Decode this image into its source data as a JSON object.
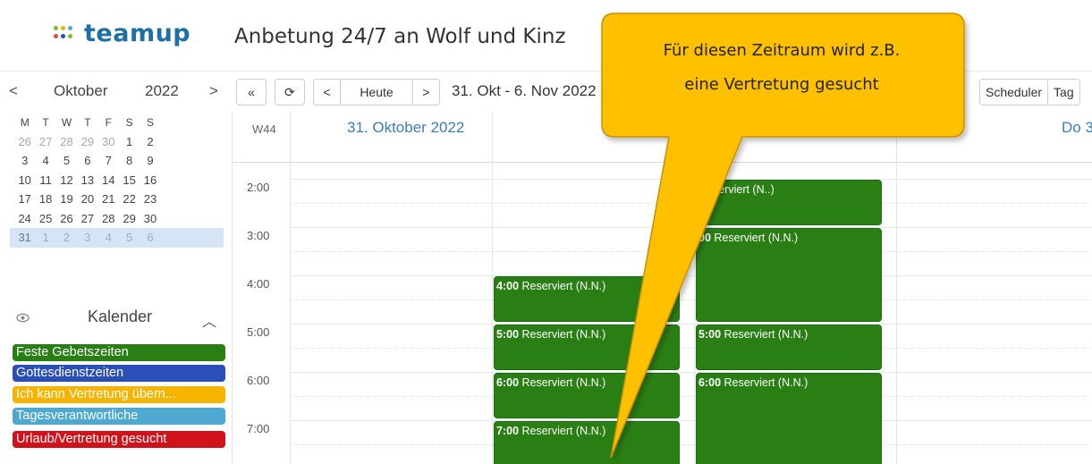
{
  "header": {
    "logo_text": "teamup",
    "title": "Anbetung 24/7 an Wolf und Kinz"
  },
  "mini_calendar": {
    "prev_label": "<",
    "next_label": ">",
    "month": "Oktober",
    "year": "2022",
    "weekdays": [
      "M",
      "T",
      "W",
      "T",
      "F",
      "S",
      "S"
    ],
    "weeks": [
      [
        "26",
        "27",
        "28",
        "29",
        "30",
        "1",
        "2"
      ],
      [
        "3",
        "4",
        "5",
        "6",
        "7",
        "8",
        "9"
      ],
      [
        "10",
        "11",
        "12",
        "13",
        "14",
        "15",
        "16"
      ],
      [
        "17",
        "18",
        "19",
        "20",
        "21",
        "22",
        "23"
      ],
      [
        "24",
        "25",
        "26",
        "27",
        "28",
        "29",
        "30"
      ],
      [
        "31",
        "1",
        "2",
        "3",
        "4",
        "5",
        "6"
      ]
    ]
  },
  "calendars": {
    "heading": "Kalender",
    "items": [
      {
        "label": "Feste Gebetszeiten",
        "color": "#2a7f14"
      },
      {
        "label": "Gottesdienstzeiten",
        "color": "#2b4fb8"
      },
      {
        "label": "Ich kann Vertretung übern...",
        "color": "#f4b400"
      },
      {
        "label": "Tagesverantwortliche",
        "color": "#4ea9d0"
      },
      {
        "label": "Urlaub/Vertretung gesucht",
        "color": "#d0121b"
      }
    ]
  },
  "toolbar": {
    "prev_period": "«",
    "refresh": "⟳",
    "prev": "<",
    "today": "Heute",
    "next": ">",
    "date_range": "31. Okt - 6. Nov 2022",
    "views": [
      "Scheduler",
      "Tag"
    ]
  },
  "grid": {
    "week_label": "W44",
    "col1_header": "31. Oktober 2022",
    "col4_header": "Do 3",
    "times": [
      "2:00",
      "3:00",
      "4:00",
      "5:00",
      "6:00",
      "7:00"
    ],
    "events": [
      {
        "time": "4:00",
        "label": "Reserviert (N.N.)",
        "col": 2,
        "start": 4,
        "end": 5
      },
      {
        "time": "5:00",
        "label": "Reserviert (N.N.)",
        "col": 2,
        "start": 5,
        "end": 6
      },
      {
        "time": "6:00",
        "label": "Reserviert (N.N.)",
        "col": 2,
        "start": 6,
        "end": 7
      },
      {
        "time": "7:00",
        "label": "Reserviert (N.N.)",
        "col": 2,
        "start": 7,
        "end": 8
      },
      {
        "time": "",
        "label": "Reserviert (N..)",
        "col": 3,
        "start": 2,
        "end": 3
      },
      {
        "time": "00",
        "label": "Reserviert (N.N.)",
        "col": 3,
        "start": 3,
        "end": 5
      },
      {
        "time": "5:00",
        "label": "Reserviert (N.N.)",
        "col": 3,
        "start": 5,
        "end": 6
      },
      {
        "time": "6:00",
        "label": "Reserviert (N.N.)",
        "col": 3,
        "start": 6,
        "end": 8
      }
    ]
  },
  "callout": {
    "line1": "Für diesen Zeitraum wird z.B.",
    "line2": "eine Vertretung gesucht",
    "fill": "#ffc000",
    "stroke": "#c98f00"
  }
}
